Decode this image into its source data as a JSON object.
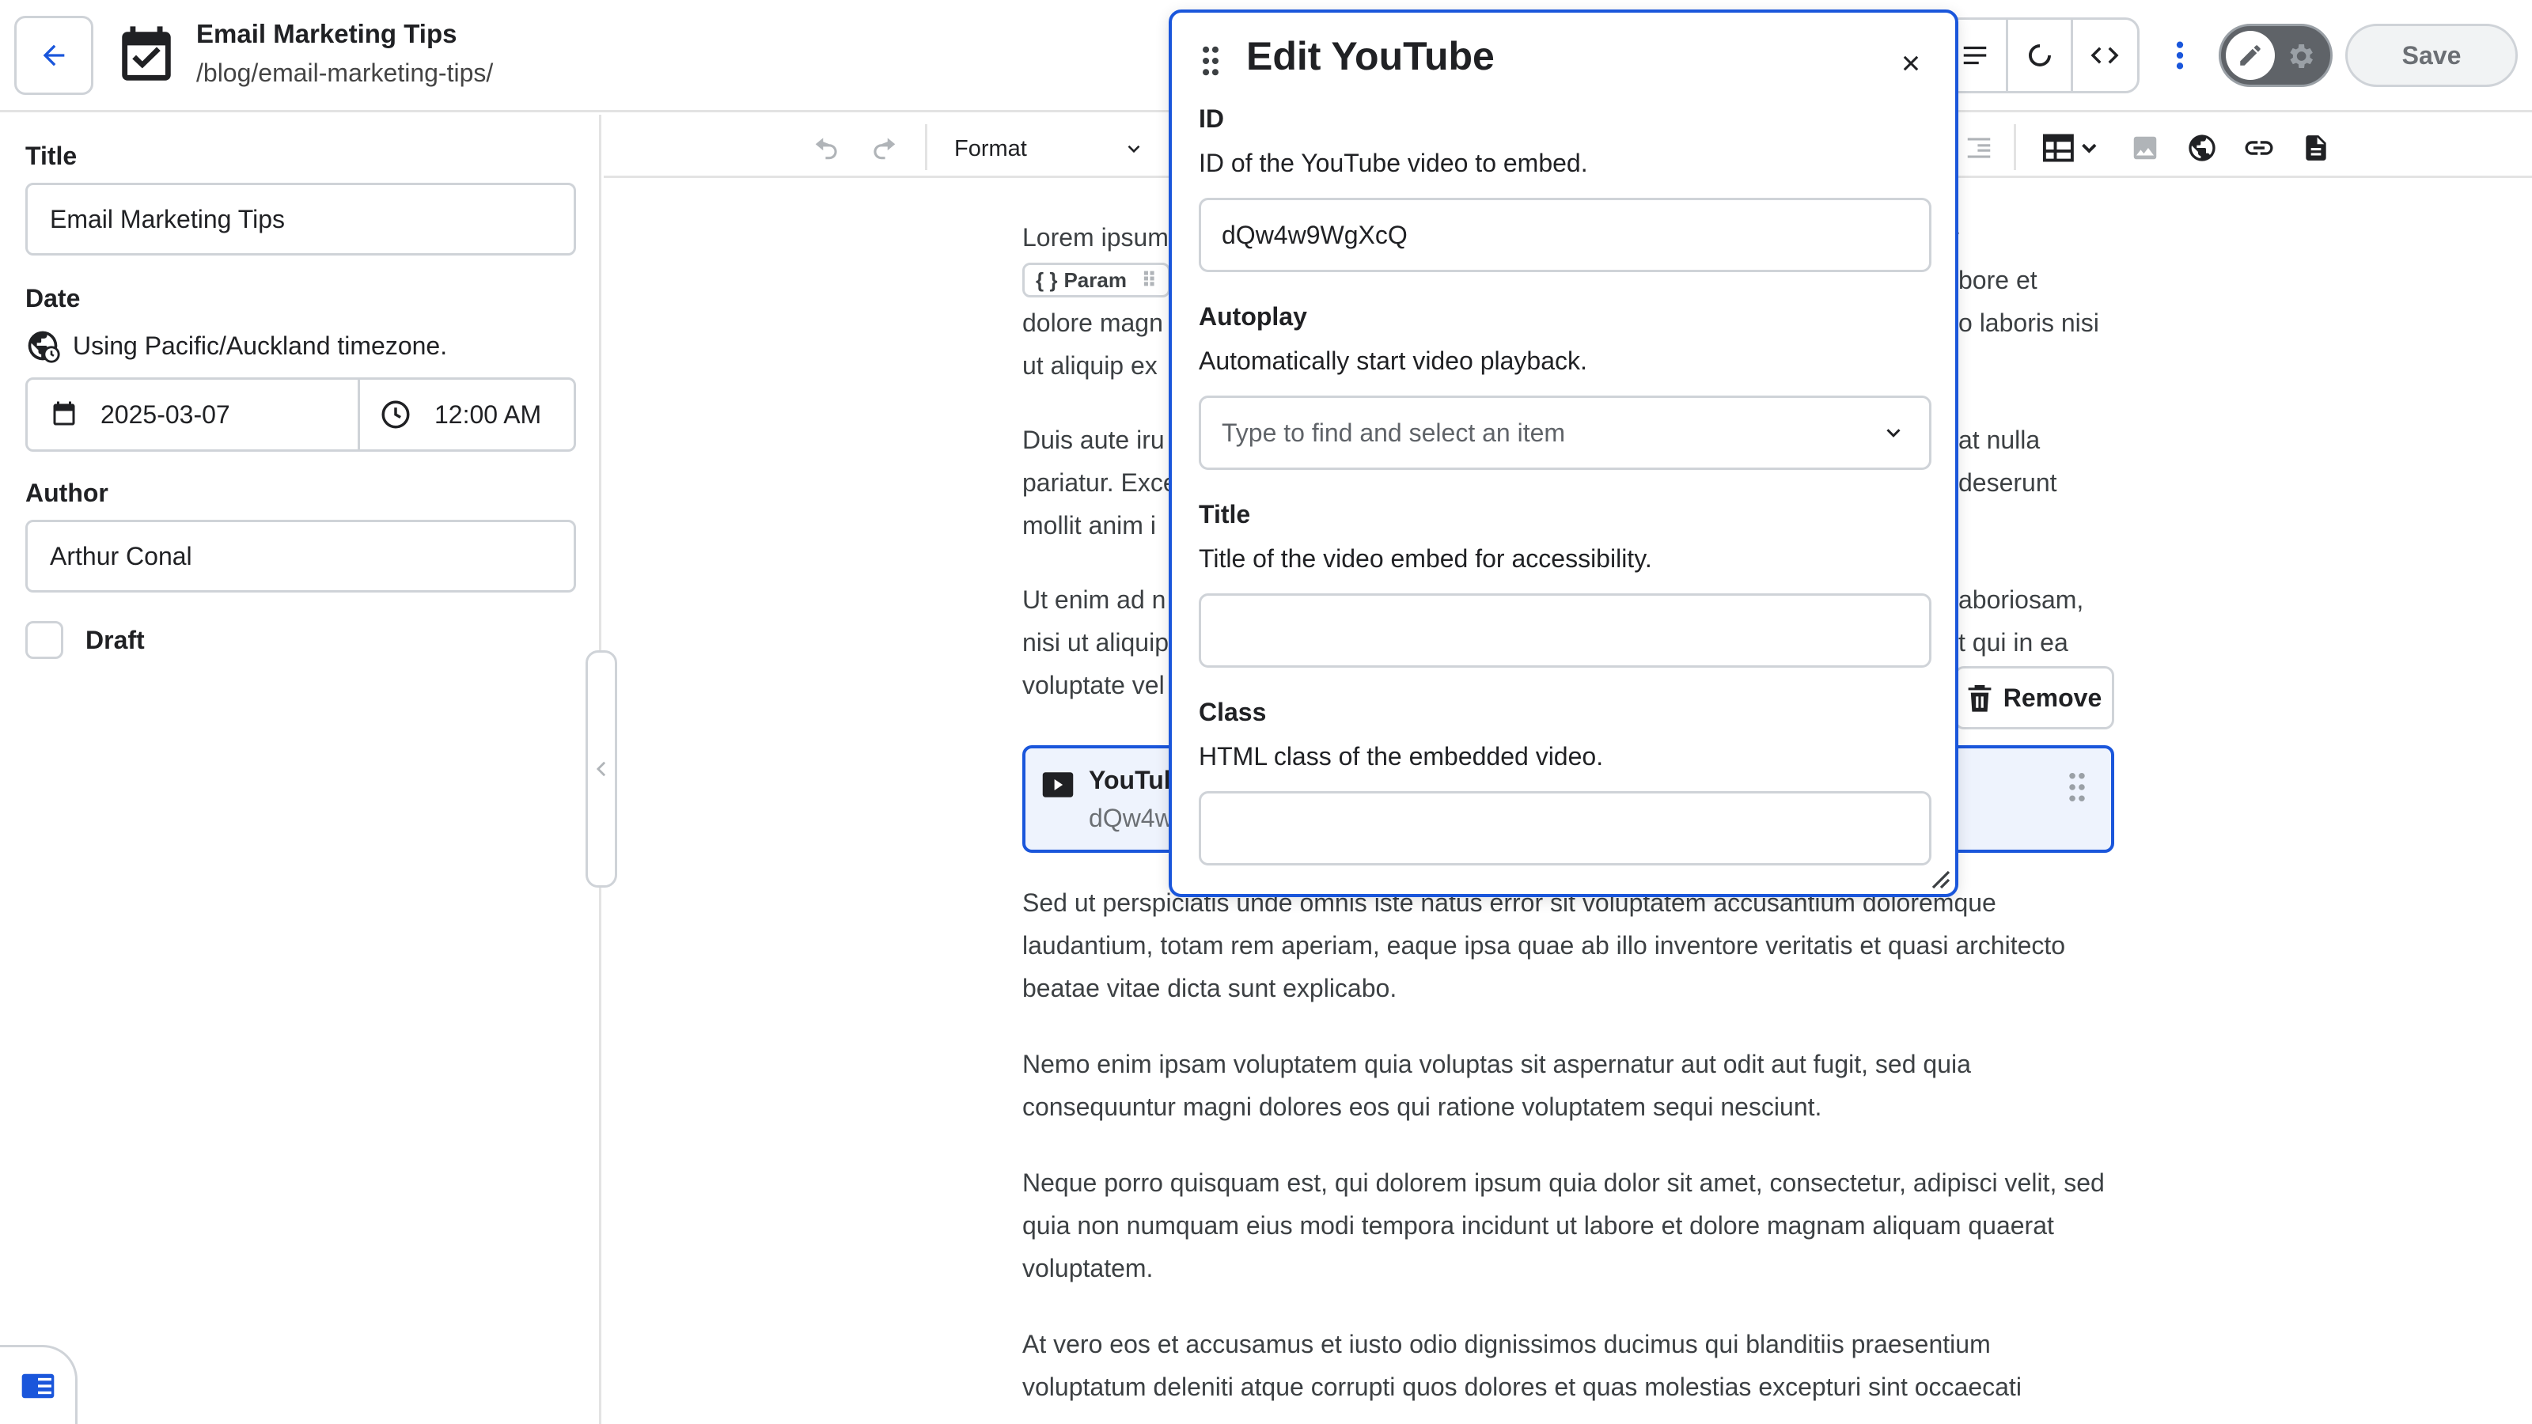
{
  "header": {
    "doc_title": "Email Marketing Tips",
    "doc_path": "/blog/email-marketing-tips/",
    "save_label": "Save"
  },
  "sidebar": {
    "title_label": "Title",
    "title_value": "Email Marketing Tips",
    "date_label": "Date",
    "timezone_text": "Using Pacific/Auckland timezone.",
    "date_value": "2025-03-07",
    "time_value": "12:00 AM",
    "author_label": "Author",
    "author_value": "Arthur Conal",
    "draft_label": "Draft"
  },
  "editor_toolbar": {
    "format_label": "Format"
  },
  "content": {
    "p1_a": "Lorem ipsum",
    "p1_b": "y",
    "param_chip": "Param",
    "p1_c": "bore et",
    "p1_d": "dolore magn",
    "p1_e": "o laboris nisi",
    "p1_f": "ut aliquip ex",
    "p2_a": "Duis aute iru",
    "p2_b": "at nulla",
    "p2_c": "pariatur. Exce",
    "p2_d": "deserunt",
    "p2_e": "mollit anim i",
    "p3_a": "Ut enim ad n",
    "p3_b": "aboriosam,",
    "p3_c": "nisi ut aliquip",
    "p3_d": "t qui in ea",
    "p3_e": "voluptate vel",
    "youtube_block_title": "YouTub",
    "youtube_block_id": "dQw4w",
    "remove_label": "Remove",
    "p4": "Sed ut perspiciatis unde omnis iste natus error sit voluptatem accusantium doloremque laudantium, totam rem aperiam, eaque ipsa quae ab illo inventore veritatis et quasi architecto beatae vitae dicta sunt explicabo.",
    "p5": "Nemo enim ipsam voluptatem quia voluptas sit aspernatur aut odit aut fugit, sed quia consequuntur magni dolores eos qui ratione voluptatem sequi nesciunt.",
    "p6": "Neque porro quisquam est, qui dolorem ipsum quia dolor sit amet, consectetur, adipisci velit, sed quia non numquam eius modi tempora incidunt ut labore et dolore magnam aliquam quaerat voluptatem.",
    "p7": "At vero eos et accusamus et iusto odio dignissimos ducimus qui blanditiis praesentium voluptatum deleniti atque corrupti quos dolores et quas molestias excepturi sint occaecati"
  },
  "modal": {
    "title": "Edit YouTube",
    "id_label": "ID",
    "id_desc": "ID of the YouTube video to embed.",
    "id_value": "dQw4w9WgXcQ",
    "autoplay_label": "Autoplay",
    "autoplay_desc": "Automatically start video playback.",
    "autoplay_placeholder": "Type to find and select an item",
    "title_label": "Title",
    "title_desc": "Title of the video embed for accessibility.",
    "title_value": "",
    "class_label": "Class",
    "class_desc": "HTML class of the embedded video.",
    "class_value": ""
  },
  "colors": {
    "accent": "#1a56db",
    "border": "#cfd3d8",
    "youtube_block_bg": "#eef3fd"
  },
  "icons": {
    "back": "arrow-left-icon",
    "document": "calendar-check-icon",
    "toolbar": [
      "text-lines-icon",
      "refresh-icon",
      "code-icon",
      "kebab-icon",
      "pencil-icon",
      "gear-icon"
    ],
    "editor": [
      "undo-icon",
      "redo-icon",
      "chevron-down-icon",
      "outdent-icon",
      "table-icon",
      "image-icon",
      "globe-icon",
      "link-icon",
      "document-icon"
    ],
    "modal": [
      "drag-handle-icon",
      "close-icon",
      "resize-icon"
    ]
  }
}
